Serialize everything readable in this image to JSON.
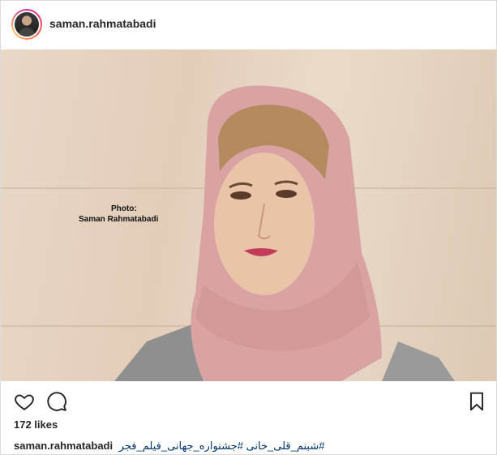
{
  "post": {
    "username": "saman.rahmatabadi",
    "photo": {
      "watermark_line1": "Photo:",
      "watermark_line2": "Saman Rahmatabadi"
    },
    "likes": "172 likes",
    "caption": {
      "username": "saman.rahmatabadi",
      "hashtags": "#شبنم_قلی_خانی #جشنواره_جهانی_فیلم_فجر"
    },
    "actions": {
      "like_icon": "heart-icon",
      "comment_icon": "comment-icon",
      "save_icon": "bookmark-icon"
    }
  },
  "colors": {
    "text": "#262626",
    "border": "#dbdbdb",
    "hashtag": "#003569",
    "scarf": "#d9a3a3"
  }
}
